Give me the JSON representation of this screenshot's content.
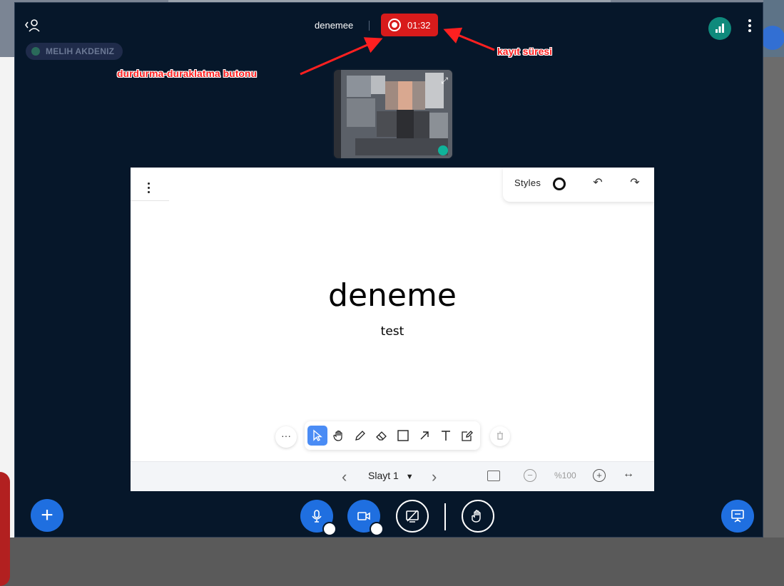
{
  "header": {
    "presenter_name": "MELIH AKDENIZ",
    "meeting_name": "denemee",
    "recording_time": "01:32"
  },
  "annotations": {
    "pause_stop_label": "durdurma-duraklatma butonu",
    "duration_label": "kayıt süresi",
    "color": "#ff2020"
  },
  "whiteboard": {
    "styles_label": "Styles",
    "slide_title": "deneme",
    "slide_subtitle": "test",
    "more_label": "···",
    "tools": [
      "select-icon",
      "hand-icon",
      "pencil-icon",
      "eraser-icon",
      "rectangle-icon",
      "arrow-icon",
      "text-icon",
      "note-icon"
    ],
    "active_tool": "select-icon",
    "slide_selector": "Slayt 1",
    "zoom_level": "%100"
  },
  "colors": {
    "window_bg": "#06172a",
    "accent": "#1f6fe0",
    "record_red": "#d81b1b",
    "connection_green": "#0f8a7c"
  }
}
